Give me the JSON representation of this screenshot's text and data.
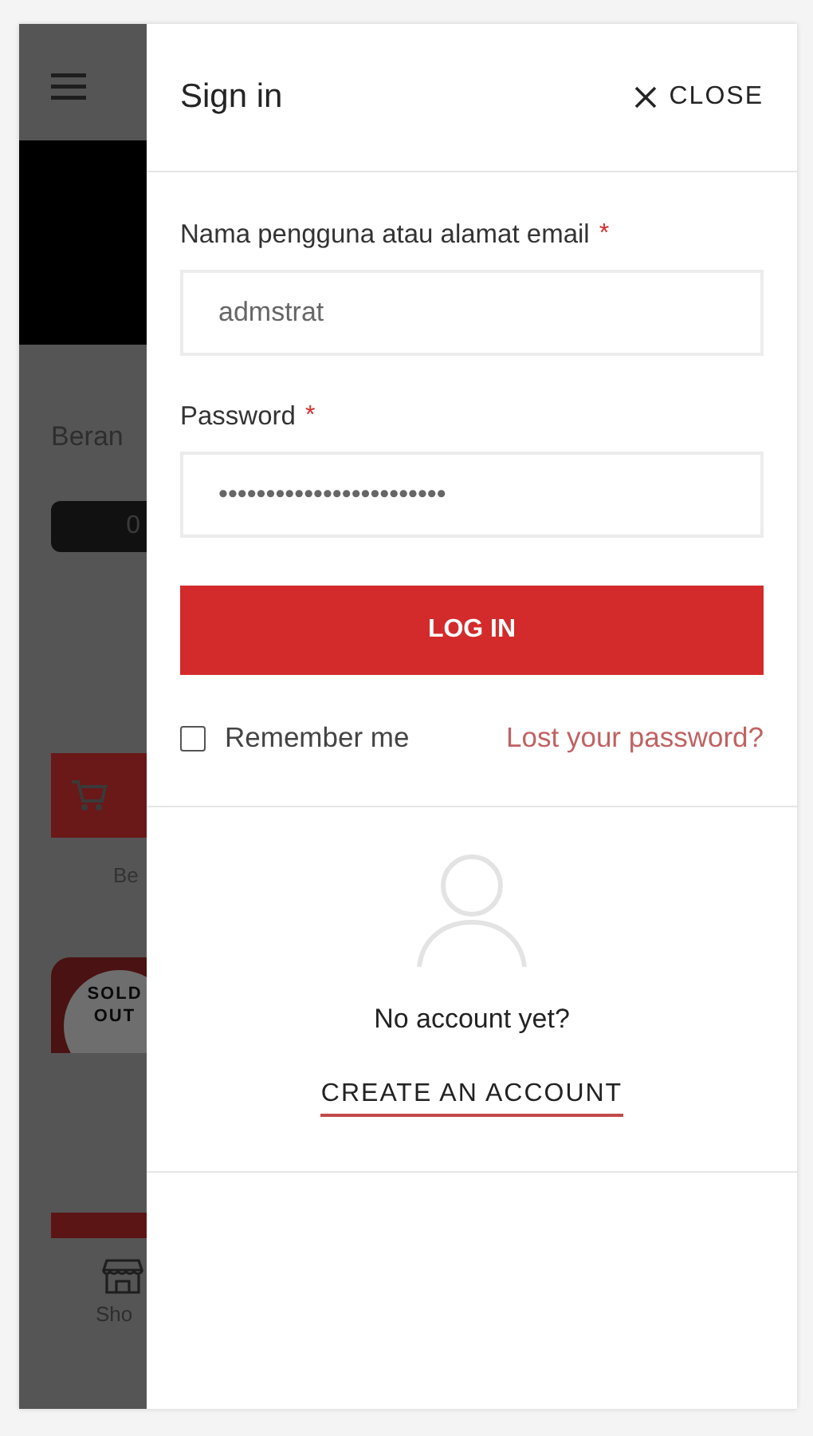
{
  "background": {
    "breadcrumb": "Beran",
    "badge": "0",
    "category_label": "Be",
    "sold_out": [
      "SOLD",
      "OUT"
    ],
    "nav_label": "Sho"
  },
  "drawer": {
    "title": "Sign in",
    "close_label": "CLOSE",
    "fields": [
      {
        "label": "Nama pengguna atau alamat email",
        "required_mark": "*",
        "value": "admstrat"
      },
      {
        "label": "Password",
        "required_mark": "*",
        "value": "••••••••••••••••••••••••"
      }
    ],
    "login_button": "LOG IN",
    "remember": {
      "label": "Remember me",
      "checked": false
    },
    "lost_password": "Lost your password?",
    "no_account": "No account yet?",
    "create_account": "CREATE AN ACCOUNT"
  }
}
